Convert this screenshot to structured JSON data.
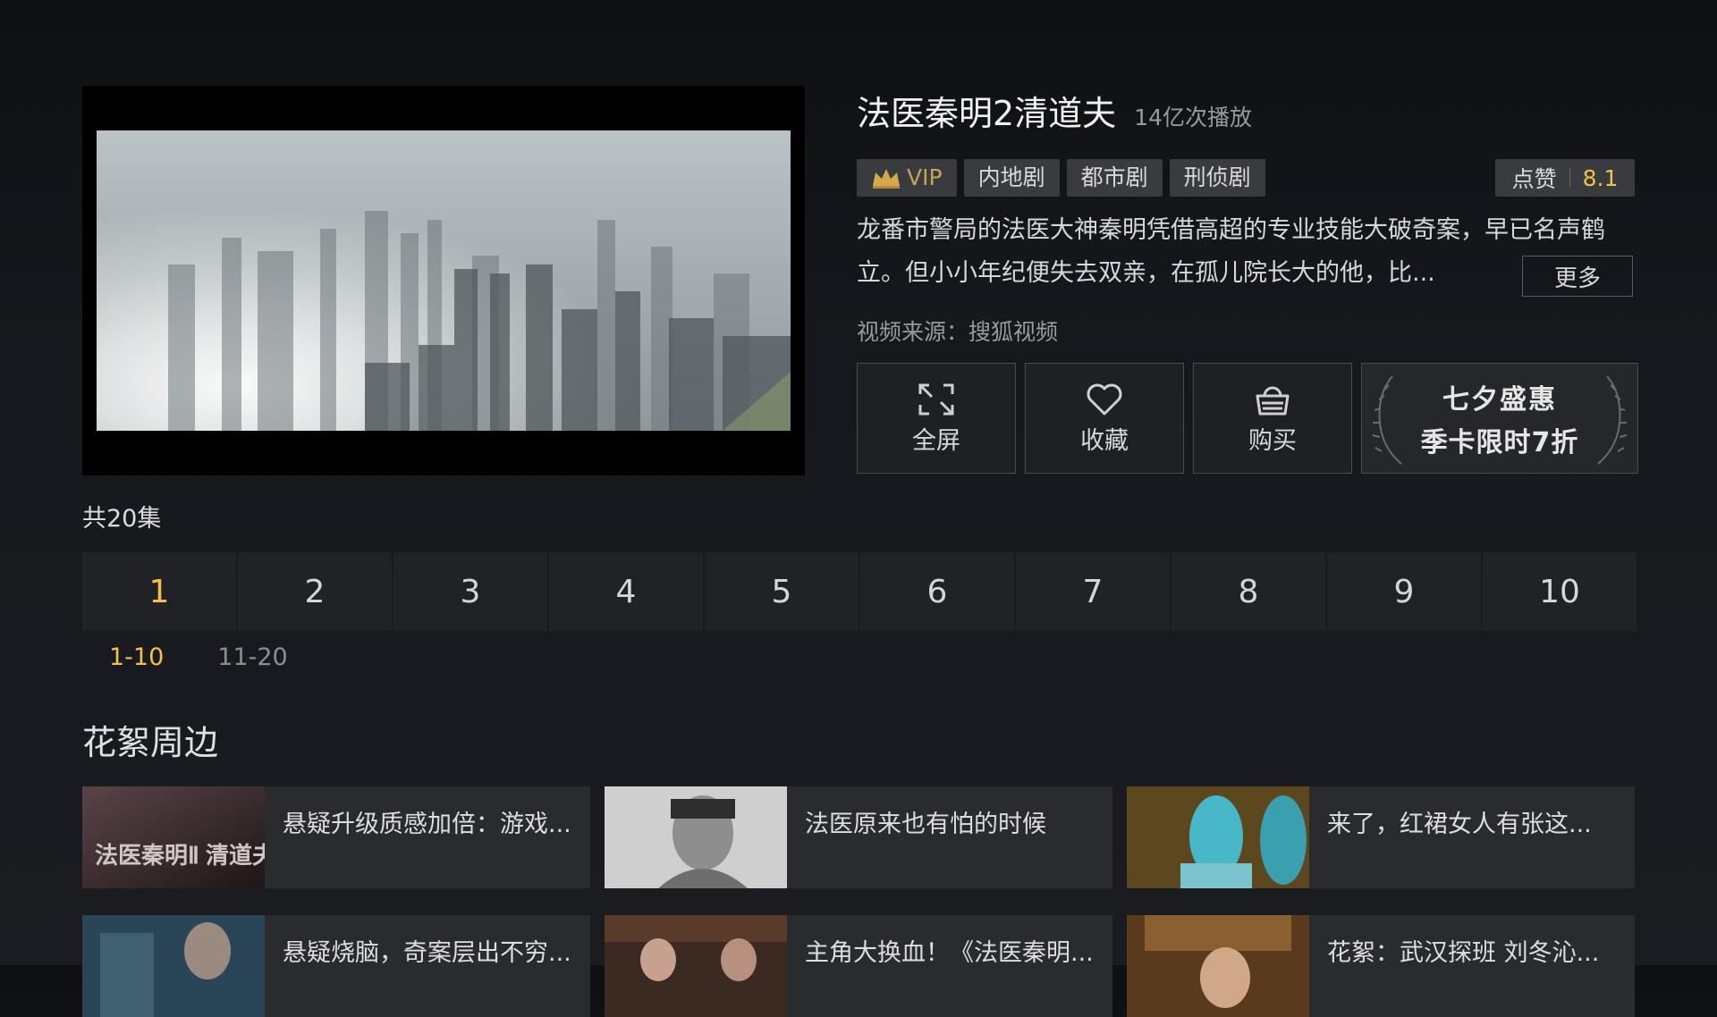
{
  "show": {
    "title": "法医秦明2清道夫",
    "plays": "14亿次播放",
    "tags": [
      "VIP",
      "内地剧",
      "都市剧",
      "刑侦剧"
    ],
    "like_label": "点赞",
    "score": "8.1",
    "description": "龙番市警局的法医大神秦明凭借高超的专业技能大破奇案，早已名声鹤立。但小小年纪便失去双亲，在孤儿院长大的他，比...",
    "more_label": "更多",
    "source": "视频来源：搜狐视频"
  },
  "actions": {
    "fullscreen": "全屏",
    "favorite": "收藏",
    "buy": "购买",
    "promo_line1": "七夕盛惠",
    "promo_line2": "季卡限时7折"
  },
  "episodes": {
    "count_label": "共20集",
    "items": [
      "1",
      "2",
      "3",
      "4",
      "5",
      "6",
      "7",
      "8",
      "9",
      "10"
    ],
    "selected": "1",
    "ranges": [
      "1-10",
      "11-20"
    ],
    "selected_range": "1-10"
  },
  "extras": {
    "title": "花絮周边",
    "items": [
      {
        "title": "悬疑升级质感加倍：游戏...",
        "thumb_text": "法医秦明Ⅱ 清道夫"
      },
      {
        "title": "法医原来也有怕的时候"
      },
      {
        "title": "来了，红裙女人有张这..."
      },
      {
        "title": "悬疑烧脑，奇案层出不穷..."
      },
      {
        "title": "主角大换血！《法医秦明..."
      },
      {
        "title": "花絮：武汉探班 刘冬沁..."
      }
    ]
  },
  "colors": {
    "accent": "#f3c04a",
    "vip": "#c9a25a",
    "background": "#16181d",
    "tile": "#202226"
  }
}
